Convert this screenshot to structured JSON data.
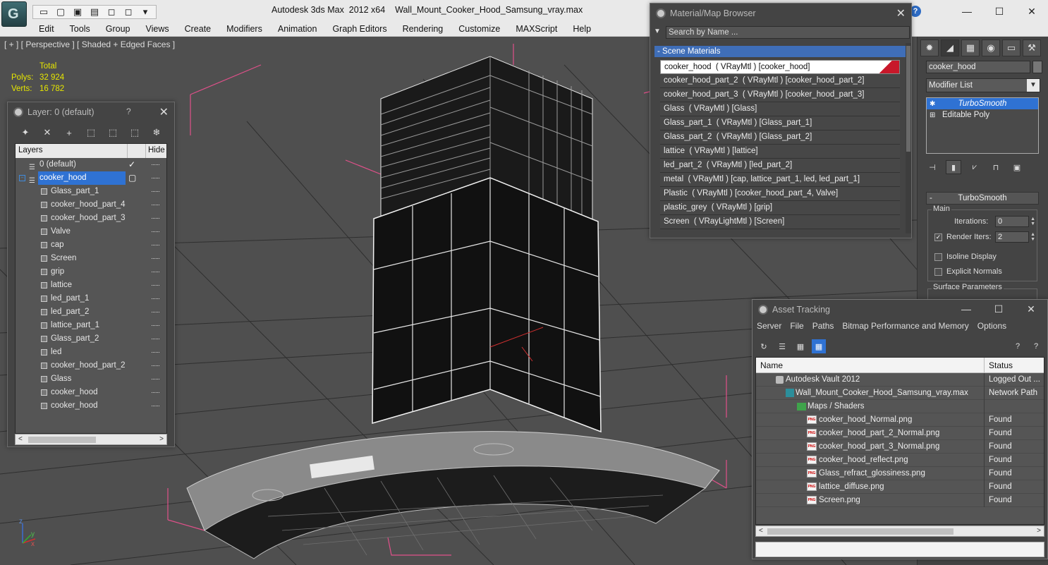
{
  "window": {
    "app_title": "Autodesk 3ds Max  2012 x64",
    "file_title": "Wall_Mount_Cooker_Hood_Samsung_vray.max",
    "minimize": "—",
    "maximize": "☐",
    "close": "✕",
    "logo": "G",
    "help": "?"
  },
  "menubar": {
    "items": [
      "Edit",
      "Tools",
      "Group",
      "Views",
      "Create",
      "Modifiers",
      "Animation",
      "Graph Editors",
      "Rendering",
      "Customize",
      "MAXScript",
      "Help"
    ]
  },
  "viewport": {
    "label": "[ + ] [ Perspective ] [ Shaded + Edged Faces ]",
    "stats": {
      "header": "Total",
      "polys_label": "Polys:",
      "polys_value": "32 924",
      "verts_label": "Verts:",
      "verts_value": "16 782"
    },
    "axis": {
      "x": "x",
      "y": "y",
      "z": "z"
    }
  },
  "layer_window": {
    "title": "Layer: 0 (default)",
    "help": "?",
    "close": "✕",
    "header": {
      "layers": "Layers",
      "hide": "Hide"
    },
    "rows": [
      {
        "name": "0 (default)",
        "kind": "layer",
        "checked": true
      },
      {
        "name": "cooker_hood",
        "kind": "layer",
        "selected": true
      },
      {
        "name": "Glass_part_1",
        "kind": "object"
      },
      {
        "name": "cooker_hood_part_4",
        "kind": "object"
      },
      {
        "name": "cooker_hood_part_3",
        "kind": "object"
      },
      {
        "name": "Valve",
        "kind": "object"
      },
      {
        "name": "cap",
        "kind": "object"
      },
      {
        "name": "Screen",
        "kind": "object"
      },
      {
        "name": "grip",
        "kind": "object"
      },
      {
        "name": "lattice",
        "kind": "object"
      },
      {
        "name": "led_part_1",
        "kind": "object"
      },
      {
        "name": "led_part_2",
        "kind": "object"
      },
      {
        "name": "lattice_part_1",
        "kind": "object"
      },
      {
        "name": "Glass_part_2",
        "kind": "object"
      },
      {
        "name": "led",
        "kind": "object"
      },
      {
        "name": "cooker_hood_part_2",
        "kind": "object"
      },
      {
        "name": "Glass",
        "kind": "object"
      },
      {
        "name": "cooker_hood",
        "kind": "object"
      },
      {
        "name": "cooker_hood",
        "kind": "object"
      }
    ]
  },
  "material_browser": {
    "title": "Material/Map Browser",
    "close": "✕",
    "search_placeholder": "Search by Name ...",
    "group": "- Scene Materials",
    "materials": [
      "cooker_hood  ( VRayMtl ) [cooker_hood]",
      "cooker_hood_part_2  ( VRayMtl ) [cooker_hood_part_2]",
      "cooker_hood_part_3  ( VRayMtl ) [cooker_hood_part_3]",
      "Glass  ( VRayMtl ) [Glass]",
      "Glass_part_1  ( VRayMtl ) [Glass_part_1]",
      "Glass_part_2  ( VRayMtl ) [Glass_part_2]",
      "lattice  ( VRayMtl ) [lattice]",
      "led_part_2  ( VRayMtl ) [led_part_2]",
      "metal  ( VRayMtl ) [cap, lattice_part_1, led, led_part_1]",
      "Plastic  ( VRayMtl ) [cooker_hood_part_4, Valve]",
      "plastic_grey  ( VRayMtl ) [grip]",
      "Screen  ( VRayLightMtl ) [Screen]"
    ]
  },
  "command_panel": {
    "object_name": "cooker_hood",
    "modifier_list": "Modifier List",
    "stack": [
      "TurboSmooth",
      "Editable Poly"
    ],
    "rollout_title": "TurboSmooth",
    "main_group": "Main",
    "iterations_label": "Iterations:",
    "iterations_value": "0",
    "render_iters_label": "Render Iters:",
    "render_iters_value": "2",
    "isoline_label": "Isoline Display",
    "explicit_normals_label": "Explicit Normals",
    "surface_params_label": "Surface Parameters"
  },
  "asset_tracking": {
    "title": "Asset Tracking",
    "menu": [
      "Server",
      "File",
      "Paths",
      "Bitmap Performance and Memory",
      "Options"
    ],
    "columns": {
      "name": "Name",
      "status": "Status"
    },
    "rows": [
      {
        "name": "Autodesk Vault 2012",
        "status": "Logged Out ...",
        "indent": 0,
        "icon": "vault"
      },
      {
        "name": "Wall_Mount_Cooker_Hood_Samsung_vray.max",
        "status": "Network Path",
        "indent": 1,
        "icon": "max"
      },
      {
        "name": "Maps / Shaders",
        "status": "",
        "indent": 2,
        "icon": "folder"
      },
      {
        "name": "cooker_hood_Normal.png",
        "status": "Found",
        "indent": 3,
        "icon": "png"
      },
      {
        "name": "cooker_hood_part_2_Normal.png",
        "status": "Found",
        "indent": 3,
        "icon": "png"
      },
      {
        "name": "cooker_hood_part_3_Normal.png",
        "status": "Found",
        "indent": 3,
        "icon": "png"
      },
      {
        "name": "cooker_hood_reflect.png",
        "status": "Found",
        "indent": 3,
        "icon": "png"
      },
      {
        "name": "Glass_refract_glossiness.png",
        "status": "Found",
        "indent": 3,
        "icon": "png"
      },
      {
        "name": "lattice_diffuse.png",
        "status": "Found",
        "indent": 3,
        "icon": "png"
      },
      {
        "name": "Screen.png",
        "status": "Found",
        "indent": 3,
        "icon": "png"
      }
    ]
  },
  "colors": {
    "selection": "#2f72d3",
    "stats_text": "#e6e600",
    "viewport_bg": "#4f4f4f",
    "wire": "#ffffff",
    "bbox_brackets": "#e0508a"
  }
}
